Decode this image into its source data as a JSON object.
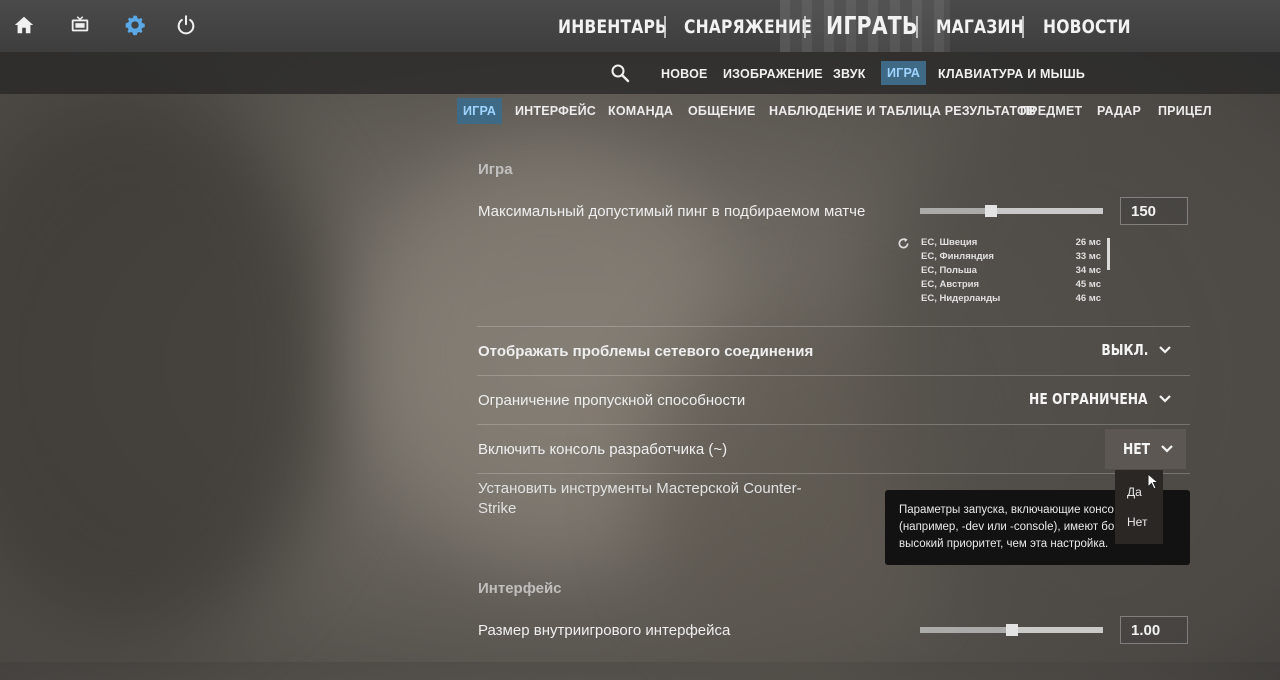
{
  "top_icons": [
    "home-icon",
    "tv-icon",
    "gear-icon",
    "power-icon"
  ],
  "main_nav": {
    "inventory": "ИНВЕНТАРЬ",
    "loadout": "СНАРЯЖЕНИЕ",
    "play": "ИГРАТЬ",
    "store": "МАГАЗИН",
    "news": "НОВОСТИ"
  },
  "settings_nav": {
    "new": "НОВОЕ",
    "video": "ИЗОБРАЖЕНИЕ",
    "audio": "ЗВУК",
    "game": "ИГРА",
    "keyboard_mouse": "КЛАВИАТУРА И МЫШЬ"
  },
  "game_tabs": {
    "game": "ИГРА",
    "interface": "ИНТЕРФЕЙС",
    "team": "КОМАНДА",
    "communication": "ОБЩЕНИЕ",
    "spectating": "НАБЛЮДЕНИЕ И ТАБЛИЦА РЕЗУЛЬТАТОВ",
    "item": "ПРЕДМЕТ",
    "radar": "РАДАР",
    "crosshair": "ПРИЦЕЛ"
  },
  "section_game": {
    "title": "Игра",
    "max_ping": {
      "label": "Максимальный допустимый пинг в подбираемом матче",
      "value": "150",
      "slider_fraction": 0.39
    },
    "servers": [
      {
        "name": "EC, Швеция",
        "ping": "26 мс"
      },
      {
        "name": "EC, Финляндия",
        "ping": "33 мс"
      },
      {
        "name": "EC, Польша",
        "ping": "34 мс"
      },
      {
        "name": "EC, Австрия",
        "ping": "45 мс"
      },
      {
        "name": "EC, Нидерланды",
        "ping": "46 мс"
      }
    ],
    "net_problems": {
      "label": "Отображать проблемы сетевого соединения",
      "value": "ВЫКЛ."
    },
    "bandwidth": {
      "label": "Ограничение пропускной способности",
      "value": "НЕ ОГРАНИЧЕНА"
    },
    "dev_console": {
      "label": "Включить консоль разработчика (~)",
      "value": "НЕТ",
      "options": [
        "Да",
        "Нет"
      ]
    },
    "workshop_tools": {
      "label_line1": "Установить инструменты Мастерской Counter-",
      "label_line2": "Strike"
    }
  },
  "tooltip": {
    "line1": "Параметры запуска, включающие консо",
    "line2": "(например, -dev или -console), имеют бо",
    "line3": "высокий приоритет, чем эта настройка."
  },
  "section_interface": {
    "title": "Интерфейс",
    "hud_scale": {
      "label": "Размер внутриигрового интерфейса",
      "value": "1.00",
      "slider_fraction": 0.5
    }
  },
  "colors": {
    "accent": "#3f6a86",
    "accent_text": "#9fd4ff",
    "gear": "#5aa9e6"
  }
}
